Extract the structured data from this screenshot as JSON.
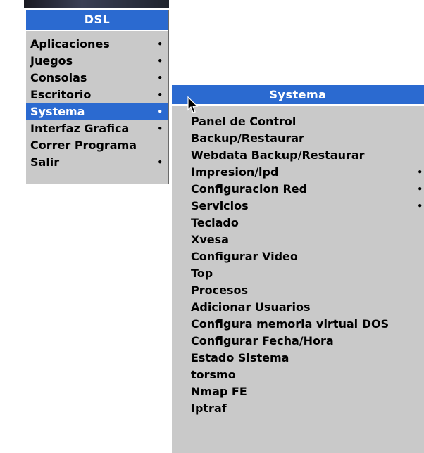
{
  "root_menu": {
    "title": "DSL",
    "items": [
      {
        "label": "Aplicaciones",
        "arrow": "•"
      },
      {
        "label": "Juegos",
        "arrow": "•"
      },
      {
        "label": "Consolas",
        "arrow": "•"
      },
      {
        "label": "Escritorio",
        "arrow": "•"
      },
      {
        "label": "Systema",
        "arrow": "•"
      },
      {
        "label": "Interfaz Grafica",
        "arrow": "•"
      },
      {
        "label": "Correr Programa",
        "arrow": ""
      },
      {
        "label": "Salir",
        "arrow": "•"
      }
    ]
  },
  "sub_menu": {
    "title": "Systema",
    "items": [
      {
        "label": "Panel de Control",
        "arrow": ""
      },
      {
        "label": "Backup/Restaurar",
        "arrow": ""
      },
      {
        "label": "Webdata Backup/Restaurar",
        "arrow": ""
      },
      {
        "label": "Impresion/lpd",
        "arrow": "•"
      },
      {
        "label": "Configuracion Red",
        "arrow": "•"
      },
      {
        "label": "Servicios",
        "arrow": "•"
      },
      {
        "label": "Teclado",
        "arrow": ""
      },
      {
        "label": "Xvesa",
        "arrow": ""
      },
      {
        "label": "Configurar Video",
        "arrow": ""
      },
      {
        "label": "Top",
        "arrow": ""
      },
      {
        "label": "Procesos",
        "arrow": ""
      },
      {
        "label": "Adicionar Usuarios",
        "arrow": ""
      },
      {
        "label": "Configura memoria virtual DOS",
        "arrow": ""
      },
      {
        "label": "Configurar Fecha/Hora",
        "arrow": ""
      },
      {
        "label": "Estado Sistema",
        "arrow": ""
      },
      {
        "label": "torsmo",
        "arrow": ""
      },
      {
        "label": "Nmap FE",
        "arrow": ""
      },
      {
        "label": "Iptraf",
        "arrow": ""
      }
    ]
  },
  "colors": {
    "highlight": "#2b6ad0",
    "menu_bg": "#c9c9c9"
  },
  "icons": {
    "cursor": "arrow-pointer-icon",
    "submenu": "submenu-arrow-icon"
  }
}
